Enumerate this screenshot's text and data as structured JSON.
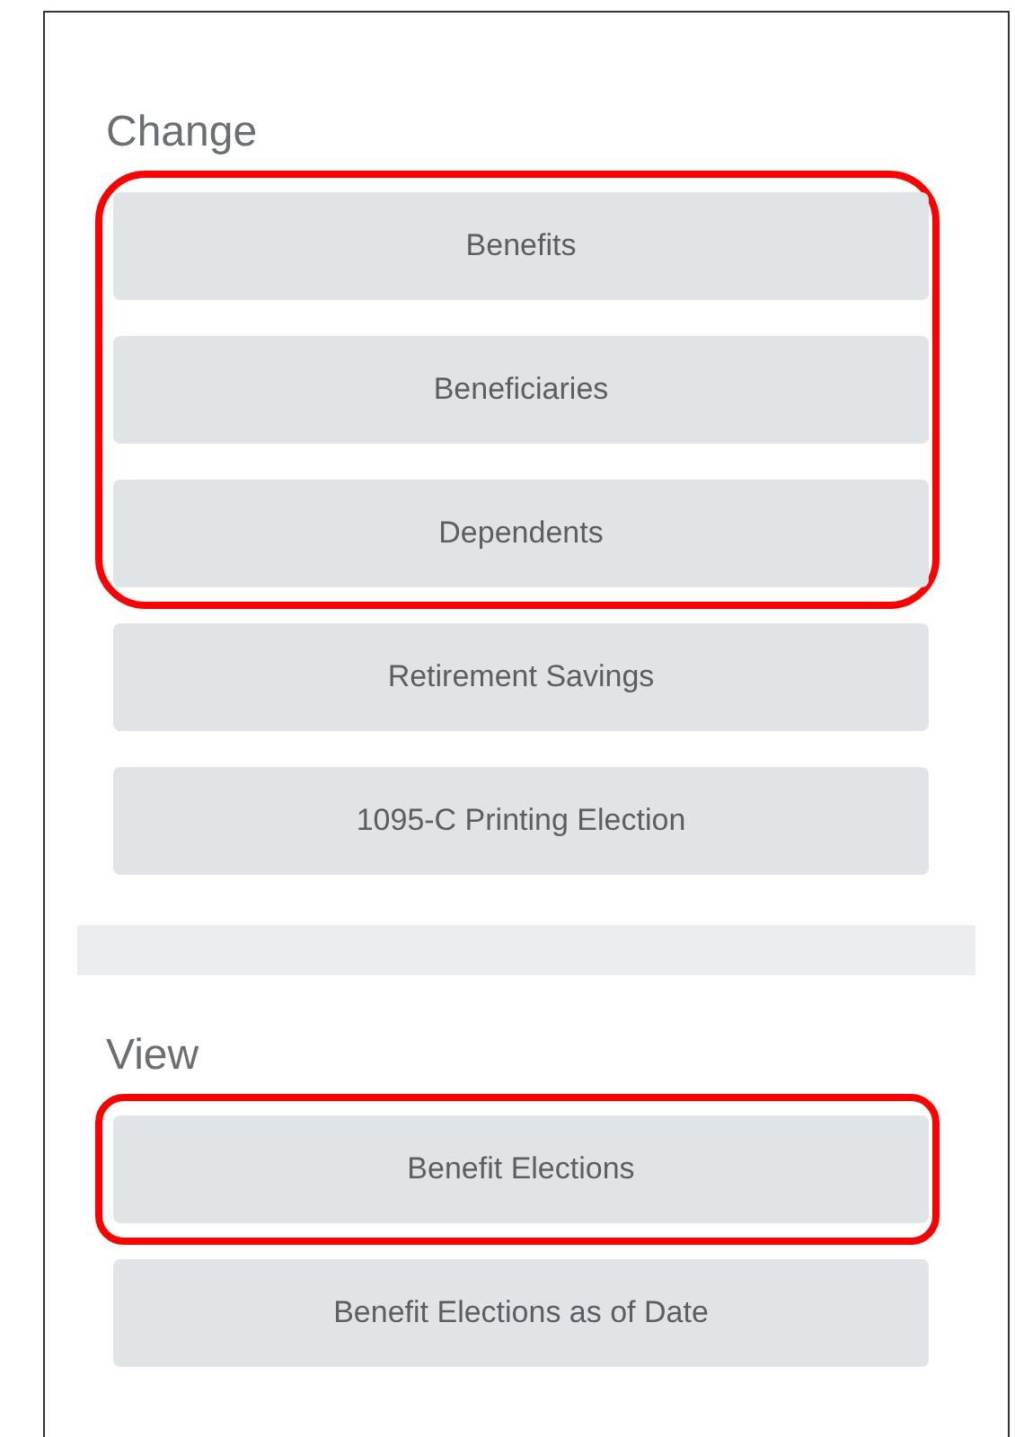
{
  "sections": [
    {
      "title": "Change",
      "groups": [
        {
          "highlighted": true,
          "buttons": [
            {
              "label": "Benefits"
            },
            {
              "label": "Beneficiaries"
            },
            {
              "label": "Dependents"
            }
          ]
        },
        {
          "highlighted": false,
          "buttons": [
            {
              "label": "Retirement Savings"
            },
            {
              "label": "1095-C Printing Election"
            }
          ]
        }
      ]
    },
    {
      "title": "View",
      "groups": [
        {
          "highlighted": true,
          "buttons": [
            {
              "label": "Benefit Elections"
            }
          ]
        },
        {
          "highlighted": false,
          "buttons": [
            {
              "label": "Benefit Elections as of Date"
            }
          ]
        }
      ]
    }
  ]
}
